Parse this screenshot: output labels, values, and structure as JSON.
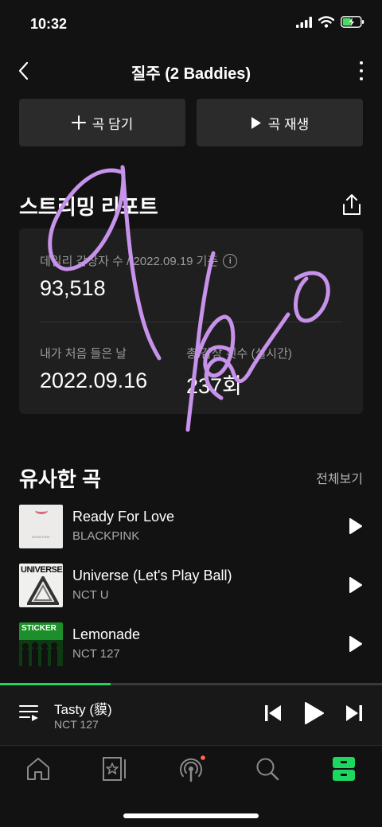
{
  "status_bar": {
    "time": "10:32"
  },
  "header": {
    "title": "질주 (2 Baddies)"
  },
  "actions": {
    "add_label": "곡 담기",
    "play_label": "곡 재생"
  },
  "report": {
    "title": "스트리밍 리포트",
    "daily_label": "데일리 감상자 수 / 2022.09.19 기준",
    "daily_value": "93,518",
    "first_listen_label": "내가 처음 들은 날",
    "first_listen_value": "2022.09.16",
    "total_plays_label": "총 감상 횟수 (실시간)",
    "total_plays_value": "237회"
  },
  "similar": {
    "title": "유사한 곡",
    "see_all": "전체보기",
    "songs": [
      {
        "title": "Ready For Love",
        "artist": "BLACKPINK",
        "art_text": "BORN PINK"
      },
      {
        "title": "Universe (Let's Play Ball)",
        "artist": "NCT U",
        "art_text": "UNIVERSE"
      },
      {
        "title": "Lemonade",
        "artist": "NCT 127",
        "art_text": "STICKER"
      }
    ]
  },
  "now_playing": {
    "title": "Tasty (貘)",
    "artist": "NCT 127",
    "progress": 0.29
  },
  "handwriting": {
    "text": "a 100"
  },
  "colors": {
    "accent": "#1ed760",
    "background": "#121212",
    "card": "#1f1f1f",
    "button": "#2b2b2b",
    "scribble": "#c792ea",
    "badge": "#ff6b4a"
  }
}
